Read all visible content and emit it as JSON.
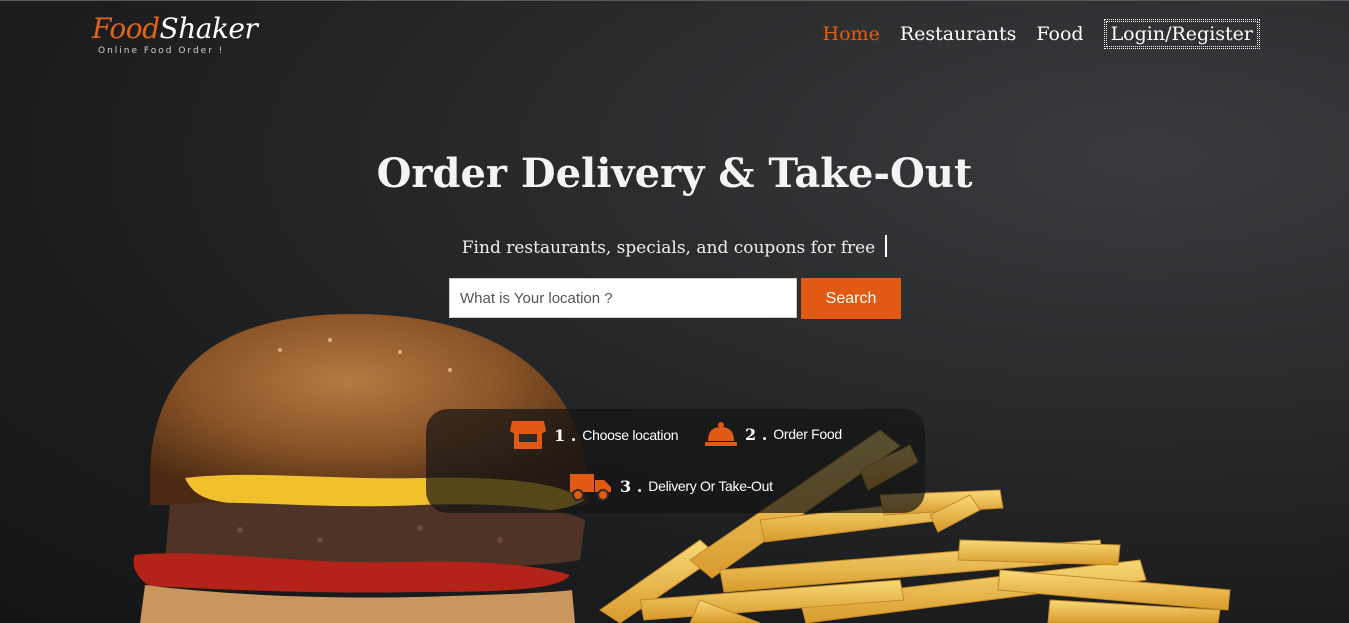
{
  "brand": {
    "name_part1": "Food",
    "name_part2": "Shaker",
    "tagline": "Online Food Order !"
  },
  "nav": {
    "items": [
      {
        "label": "Home",
        "active": true
      },
      {
        "label": "Restaurants",
        "active": false
      },
      {
        "label": "Food",
        "active": false
      },
      {
        "label": "Login/Register",
        "active": false
      }
    ]
  },
  "hero": {
    "title": "Order Delivery & Take-Out",
    "subtitle": "Find restaurants, specials, and coupons for free"
  },
  "search": {
    "placeholder": "What is Your location ?",
    "button_label": "Search"
  },
  "steps": [
    {
      "number": "1 .",
      "label": "Choose location",
      "icon": "store-icon"
    },
    {
      "number": "2 .",
      "label": "Order Food",
      "icon": "cloche-icon"
    },
    {
      "number": "3 .",
      "label": "Delivery Or Take-Out",
      "icon": "truck-icon"
    }
  ],
  "colors": {
    "accent": "#e05a13",
    "active_nav": "#e85c0d",
    "background": "#1c1d1f"
  }
}
